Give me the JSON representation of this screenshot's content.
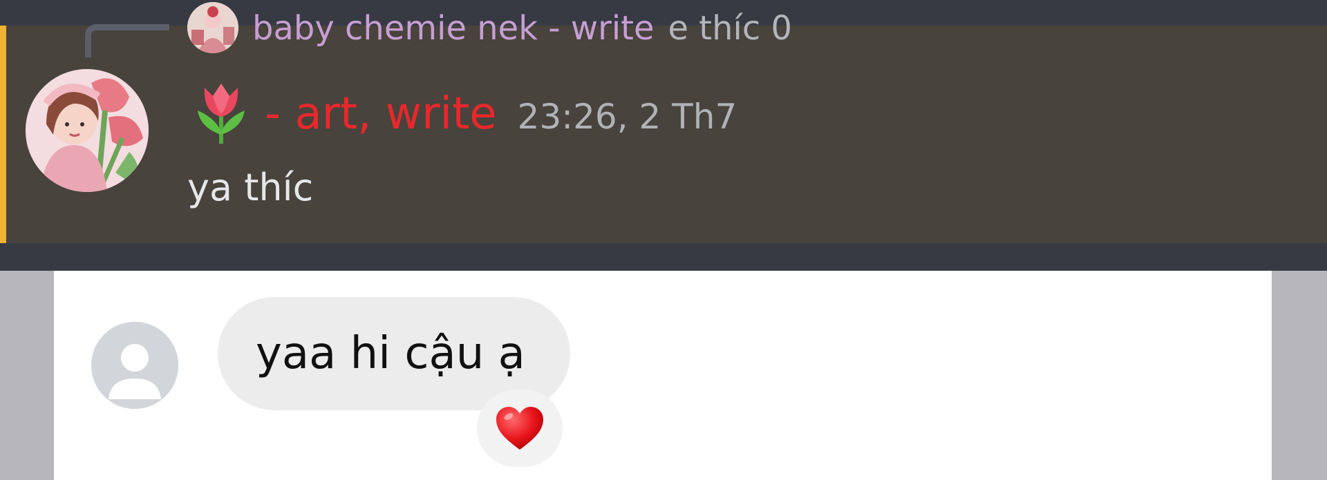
{
  "discord_message": {
    "reply": {
      "author": "baby chemie nek - write",
      "preview": "e thíc 0"
    },
    "author_icon": "tulip-icon",
    "author_name": "- art, write",
    "timestamp": "23:26, 2 Th7",
    "body": "ya thíc",
    "colors": {
      "background": "#373a43",
      "highlight": "#48433c",
      "accent_bar": "#f0b232",
      "author": "#e8282c",
      "reply_author": "#c79fd3"
    }
  },
  "messenger_message": {
    "text": "yaa hi cậu ạ",
    "reaction": "heart-icon",
    "colors": {
      "bubble": "#ececed",
      "reaction": "#e8151b"
    }
  }
}
